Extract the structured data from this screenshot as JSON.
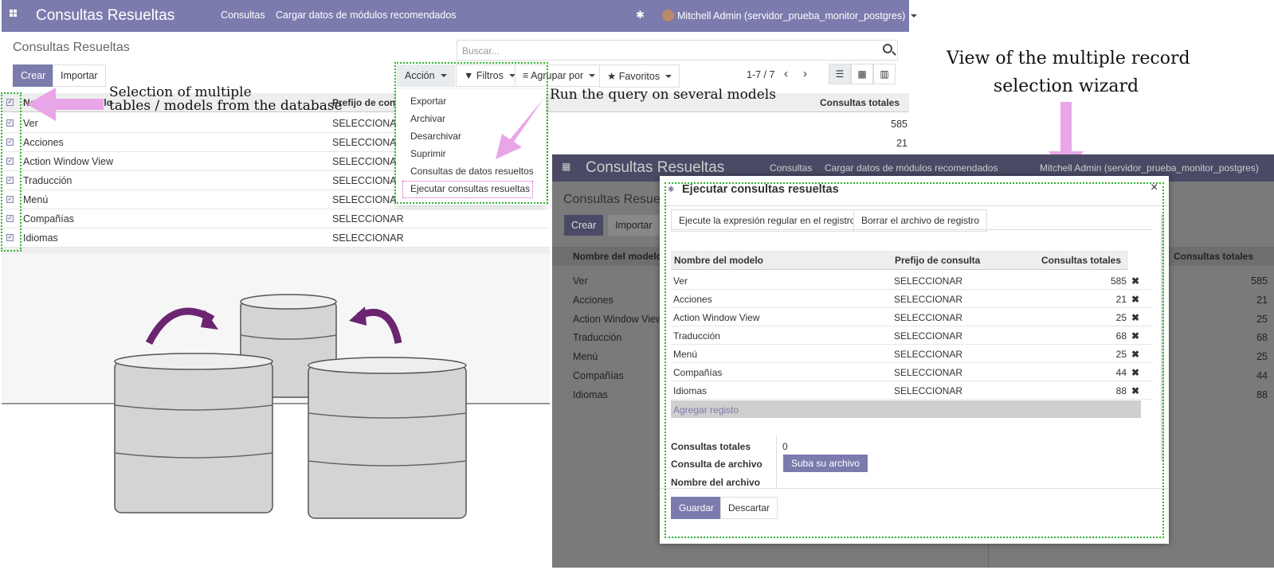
{
  "nav": {
    "brand": "Consultas Resueltas",
    "menu": [
      "Consultas",
      "Cargar datos de módulos recomendados"
    ],
    "user": "Mitchell Admin (servidor_prueba_monitor_postgres)"
  },
  "page_title": "Consultas Resueltas",
  "search": {
    "placeholder": "Buscar..."
  },
  "buttons": {
    "create": "Crear",
    "import": "Importar",
    "action": "Acción",
    "filters": "Filtros",
    "group_by": "Agrupar por",
    "favorites": "Favoritos"
  },
  "pager": "1-7 / 7",
  "columns": {
    "model": "Nombre del modelo",
    "prefix": "Prefijo de consulta",
    "prefix_trunc": "Prefijo de cons",
    "total": "Consultas totales"
  },
  "rows": [
    {
      "name": "Ver",
      "prefix": "SELECCIONAR",
      "total": "585"
    },
    {
      "name": "Acciones",
      "prefix": "SELECCIONAR",
      "total": "21"
    },
    {
      "name": "Action Window View",
      "prefix": "SELECCIONAR",
      "total": "25"
    },
    {
      "name": "Traducción",
      "prefix": "SELECCIONAR",
      "total": "68"
    },
    {
      "name": "Menú",
      "prefix": "SELECCIONAR",
      "total": "25"
    },
    {
      "name": "Compañías",
      "prefix": "SELECCIONAR",
      "total": "44"
    },
    {
      "name": "Idiomas",
      "prefix": "SELECCIONAR",
      "total": "88"
    }
  ],
  "action_menu": [
    "Exportar",
    "Archivar",
    "Desarchivar",
    "Suprimir",
    "Consultas de datos resueltos",
    "Ejecutar consultas resueltas"
  ],
  "annotations": {
    "selection_line1": "Selection of multiple",
    "selection_line2": "tables / models from the database",
    "run_query": "Run the query on several models",
    "wizard_line1": "View of the multiple record",
    "wizard_line2": "selection wizard"
  },
  "modal": {
    "title": "Ejecutar consultas resueltas",
    "btn_regex": "Ejecute la expresión regular en el registro",
    "btn_clear": "Borrar el archivo de registro",
    "add_record": "Agregar registo",
    "total_label": "Consultas totales",
    "total_value": "0",
    "file_label": "Consulta de archivo",
    "upload": "Suba su archivo",
    "filename_label": "Nombre del archivo",
    "save": "Guardar",
    "discard": "Descartar"
  },
  "colors": {
    "brand": "#7c7bad",
    "annotation_arrow": "#e8a6e8",
    "selection_border": "#2fb52f",
    "highlight_border": "#d04bd0"
  }
}
